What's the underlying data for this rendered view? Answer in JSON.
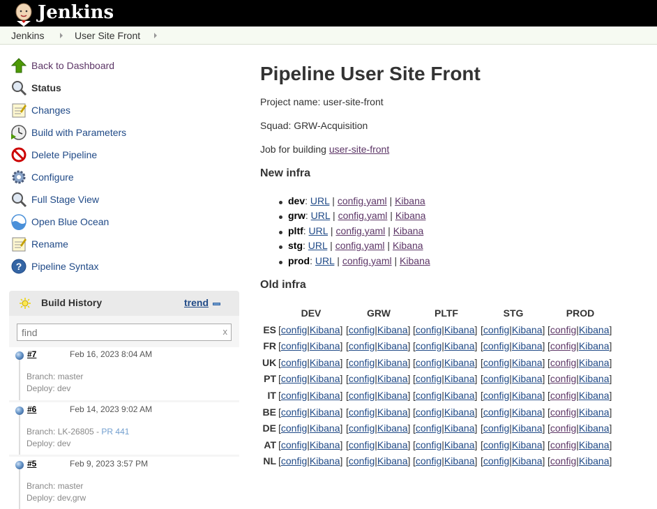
{
  "header": {
    "brand": "Jenkins",
    "logo_icon": "jenkins-butler-icon"
  },
  "breadcrumb": [
    {
      "label": "Jenkins"
    },
    {
      "label": "User Site Front"
    }
  ],
  "side_tasks": [
    {
      "label": "Back to Dashboard",
      "icon": "up-arrow-icon"
    },
    {
      "label": "Status",
      "icon": "search-icon"
    },
    {
      "label": "Changes",
      "icon": "notepad-icon"
    },
    {
      "label": "Build with Parameters",
      "icon": "clock-play-icon"
    },
    {
      "label": "Delete Pipeline",
      "icon": "no-entry-icon"
    },
    {
      "label": "Configure",
      "icon": "gear-icon"
    },
    {
      "label": "Full Stage View",
      "icon": "search-icon"
    },
    {
      "label": "Open Blue Ocean",
      "icon": "blue-ocean-icon"
    },
    {
      "label": "Rename",
      "icon": "notepad-icon"
    },
    {
      "label": "Pipeline Syntax",
      "icon": "help-icon"
    }
  ],
  "build_history": {
    "title": "Build History",
    "trend_label": "trend",
    "search_placeholder": "find",
    "clear_label": "x",
    "builds": [
      {
        "number": "#7",
        "date": "Feb 16, 2023 8:04 AM",
        "branch": "Branch: master",
        "deploy": "Deploy: dev"
      },
      {
        "number": "#6",
        "date": "Feb 14, 2023 9:02 AM",
        "branch": "Branch: LK-26805 - ",
        "pr_link": "PR 441",
        "deploy": "Deploy: dev"
      },
      {
        "number": "#5",
        "date": "Feb 9, 2023 3:57 PM",
        "branch": "Branch: master",
        "deploy": "Deploy: dev,grw"
      }
    ]
  },
  "main": {
    "title": "Pipeline User Site Front",
    "project_name": "Project name: user-site-front",
    "squad": "Squad: GRW-Acquisition",
    "job_text": "Job for building ",
    "job_link": "user-site-front",
    "new_infra_heading": "New infra",
    "new_infra": [
      {
        "env": "dev",
        "url": "URL",
        "config": "config.yaml",
        "kibana": "Kibana"
      },
      {
        "env": "grw",
        "url": "URL",
        "config": "config.yaml",
        "kibana": "Kibana"
      },
      {
        "env": "pltf",
        "url": "URL",
        "config": "config.yaml",
        "kibana": "Kibana"
      },
      {
        "env": "stg",
        "url": "URL",
        "config": "config.yaml",
        "kibana": "Kibana"
      },
      {
        "env": "prod",
        "url": "URL",
        "config": "config.yaml",
        "kibana": "Kibana"
      }
    ],
    "old_infra_heading": "Old infra",
    "old_infra_columns": [
      "DEV",
      "GRW",
      "PLTF",
      "STG",
      "PROD"
    ],
    "old_infra_rows": [
      "ES",
      "FR",
      "UK",
      "PT",
      "IT",
      "BE",
      "DE",
      "AT",
      "NL"
    ],
    "cell_config": "config",
    "cell_kibana": "Kibana"
  },
  "colors": {
    "header_bg": "#000000",
    "link": "#204a87",
    "visited_link": "#5c3566",
    "breadcrumb_bg": "#f6faf2"
  }
}
